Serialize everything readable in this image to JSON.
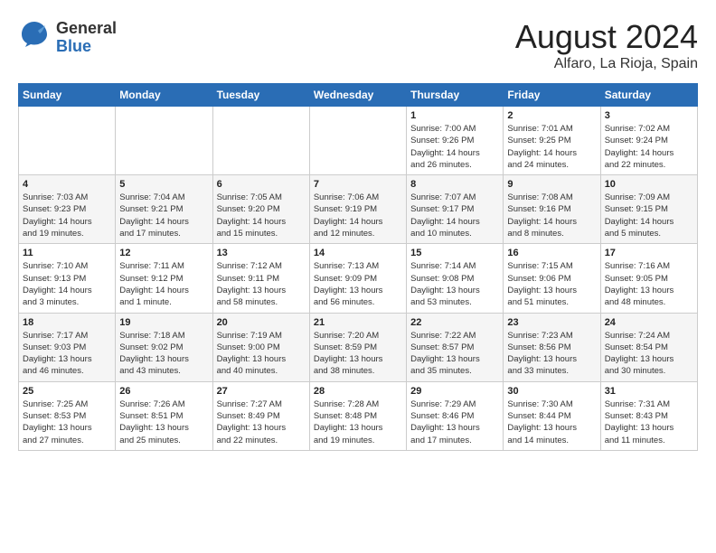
{
  "logo": {
    "general": "General",
    "blue": "Blue"
  },
  "title": {
    "month": "August 2024",
    "location": "Alfaro, La Rioja, Spain"
  },
  "days_of_week": [
    "Sunday",
    "Monday",
    "Tuesday",
    "Wednesday",
    "Thursday",
    "Friday",
    "Saturday"
  ],
  "weeks": [
    [
      {
        "day": "",
        "info": ""
      },
      {
        "day": "",
        "info": ""
      },
      {
        "day": "",
        "info": ""
      },
      {
        "day": "",
        "info": ""
      },
      {
        "day": "1",
        "info": "Sunrise: 7:00 AM\nSunset: 9:26 PM\nDaylight: 14 hours\nand 26 minutes."
      },
      {
        "day": "2",
        "info": "Sunrise: 7:01 AM\nSunset: 9:25 PM\nDaylight: 14 hours\nand 24 minutes."
      },
      {
        "day": "3",
        "info": "Sunrise: 7:02 AM\nSunset: 9:24 PM\nDaylight: 14 hours\nand 22 minutes."
      }
    ],
    [
      {
        "day": "4",
        "info": "Sunrise: 7:03 AM\nSunset: 9:23 PM\nDaylight: 14 hours\nand 19 minutes."
      },
      {
        "day": "5",
        "info": "Sunrise: 7:04 AM\nSunset: 9:21 PM\nDaylight: 14 hours\nand 17 minutes."
      },
      {
        "day": "6",
        "info": "Sunrise: 7:05 AM\nSunset: 9:20 PM\nDaylight: 14 hours\nand 15 minutes."
      },
      {
        "day": "7",
        "info": "Sunrise: 7:06 AM\nSunset: 9:19 PM\nDaylight: 14 hours\nand 12 minutes."
      },
      {
        "day": "8",
        "info": "Sunrise: 7:07 AM\nSunset: 9:17 PM\nDaylight: 14 hours\nand 10 minutes."
      },
      {
        "day": "9",
        "info": "Sunrise: 7:08 AM\nSunset: 9:16 PM\nDaylight: 14 hours\nand 8 minutes."
      },
      {
        "day": "10",
        "info": "Sunrise: 7:09 AM\nSunset: 9:15 PM\nDaylight: 14 hours\nand 5 minutes."
      }
    ],
    [
      {
        "day": "11",
        "info": "Sunrise: 7:10 AM\nSunset: 9:13 PM\nDaylight: 14 hours\nand 3 minutes."
      },
      {
        "day": "12",
        "info": "Sunrise: 7:11 AM\nSunset: 9:12 PM\nDaylight: 14 hours\nand 1 minute."
      },
      {
        "day": "13",
        "info": "Sunrise: 7:12 AM\nSunset: 9:11 PM\nDaylight: 13 hours\nand 58 minutes."
      },
      {
        "day": "14",
        "info": "Sunrise: 7:13 AM\nSunset: 9:09 PM\nDaylight: 13 hours\nand 56 minutes."
      },
      {
        "day": "15",
        "info": "Sunrise: 7:14 AM\nSunset: 9:08 PM\nDaylight: 13 hours\nand 53 minutes."
      },
      {
        "day": "16",
        "info": "Sunrise: 7:15 AM\nSunset: 9:06 PM\nDaylight: 13 hours\nand 51 minutes."
      },
      {
        "day": "17",
        "info": "Sunrise: 7:16 AM\nSunset: 9:05 PM\nDaylight: 13 hours\nand 48 minutes."
      }
    ],
    [
      {
        "day": "18",
        "info": "Sunrise: 7:17 AM\nSunset: 9:03 PM\nDaylight: 13 hours\nand 46 minutes."
      },
      {
        "day": "19",
        "info": "Sunrise: 7:18 AM\nSunset: 9:02 PM\nDaylight: 13 hours\nand 43 minutes."
      },
      {
        "day": "20",
        "info": "Sunrise: 7:19 AM\nSunset: 9:00 PM\nDaylight: 13 hours\nand 40 minutes."
      },
      {
        "day": "21",
        "info": "Sunrise: 7:20 AM\nSunset: 8:59 PM\nDaylight: 13 hours\nand 38 minutes."
      },
      {
        "day": "22",
        "info": "Sunrise: 7:22 AM\nSunset: 8:57 PM\nDaylight: 13 hours\nand 35 minutes."
      },
      {
        "day": "23",
        "info": "Sunrise: 7:23 AM\nSunset: 8:56 PM\nDaylight: 13 hours\nand 33 minutes."
      },
      {
        "day": "24",
        "info": "Sunrise: 7:24 AM\nSunset: 8:54 PM\nDaylight: 13 hours\nand 30 minutes."
      }
    ],
    [
      {
        "day": "25",
        "info": "Sunrise: 7:25 AM\nSunset: 8:53 PM\nDaylight: 13 hours\nand 27 minutes."
      },
      {
        "day": "26",
        "info": "Sunrise: 7:26 AM\nSunset: 8:51 PM\nDaylight: 13 hours\nand 25 minutes."
      },
      {
        "day": "27",
        "info": "Sunrise: 7:27 AM\nSunset: 8:49 PM\nDaylight: 13 hours\nand 22 minutes."
      },
      {
        "day": "28",
        "info": "Sunrise: 7:28 AM\nSunset: 8:48 PM\nDaylight: 13 hours\nand 19 minutes."
      },
      {
        "day": "29",
        "info": "Sunrise: 7:29 AM\nSunset: 8:46 PM\nDaylight: 13 hours\nand 17 minutes."
      },
      {
        "day": "30",
        "info": "Sunrise: 7:30 AM\nSunset: 8:44 PM\nDaylight: 13 hours\nand 14 minutes."
      },
      {
        "day": "31",
        "info": "Sunrise: 7:31 AM\nSunset: 8:43 PM\nDaylight: 13 hours\nand 11 minutes."
      }
    ]
  ]
}
